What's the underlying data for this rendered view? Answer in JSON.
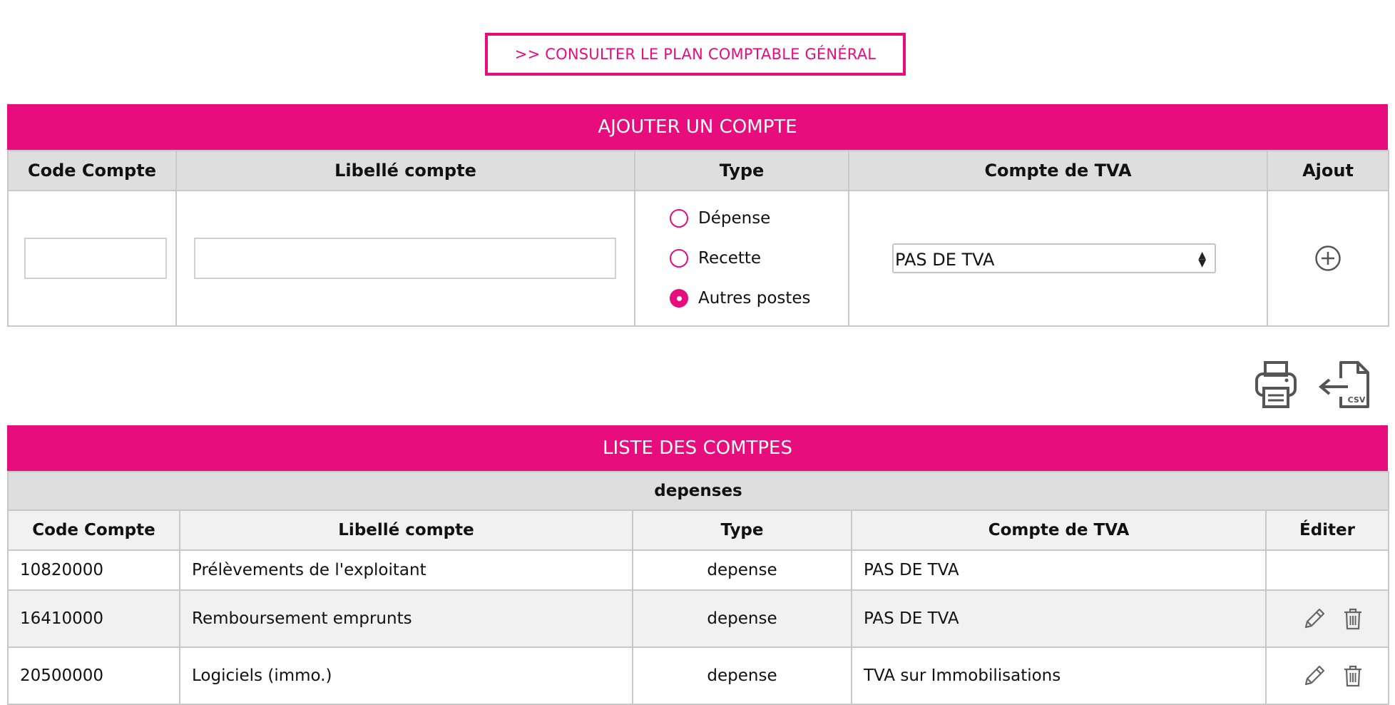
{
  "consult_button": {
    "label": ">> CONSULTER LE PLAN COMPTABLE GÉNÉRAL"
  },
  "add_section": {
    "title": "AJOUTER UN COMPTE",
    "columns": [
      "Code Compte",
      "Libellé compte",
      "Type",
      "Compte de TVA",
      "Ajout"
    ],
    "code_value": "",
    "label_value": "",
    "type_options": [
      {
        "label": "Dépense",
        "checked": false
      },
      {
        "label": "Recette",
        "checked": false
      },
      {
        "label": "Autres postes",
        "checked": true
      }
    ],
    "tva_select": {
      "selected": "PAS DE TVA"
    },
    "add_icon": "plus-circle-icon"
  },
  "toolbar": {
    "icons": [
      "printer-icon",
      "csv-export-icon"
    ],
    "csv_text": "CSV"
  },
  "list_section": {
    "title": "LISTE DES COMTPES",
    "group": "depenses",
    "columns": [
      "Code Compte",
      "Libellé compte",
      "Type",
      "Compte de TVA",
      "Éditer"
    ],
    "rows": [
      {
        "code": "10820000",
        "label": "Prélèvements de l'exploitant",
        "type": "depense",
        "tva": "PAS DE TVA",
        "editable": false
      },
      {
        "code": "16410000",
        "label": "Remboursement emprunts",
        "type": "depense",
        "tva": "PAS DE TVA",
        "editable": true
      },
      {
        "code": "20500000",
        "label": "Logiciels (immo.)",
        "type": "depense",
        "tva": "TVA sur Immobilisations",
        "editable": true
      }
    ]
  },
  "colors": {
    "accent": "#e80d7d",
    "header_gray": "#dedede",
    "row_alt": "#f1f1f1",
    "border": "#c8c8c8"
  }
}
